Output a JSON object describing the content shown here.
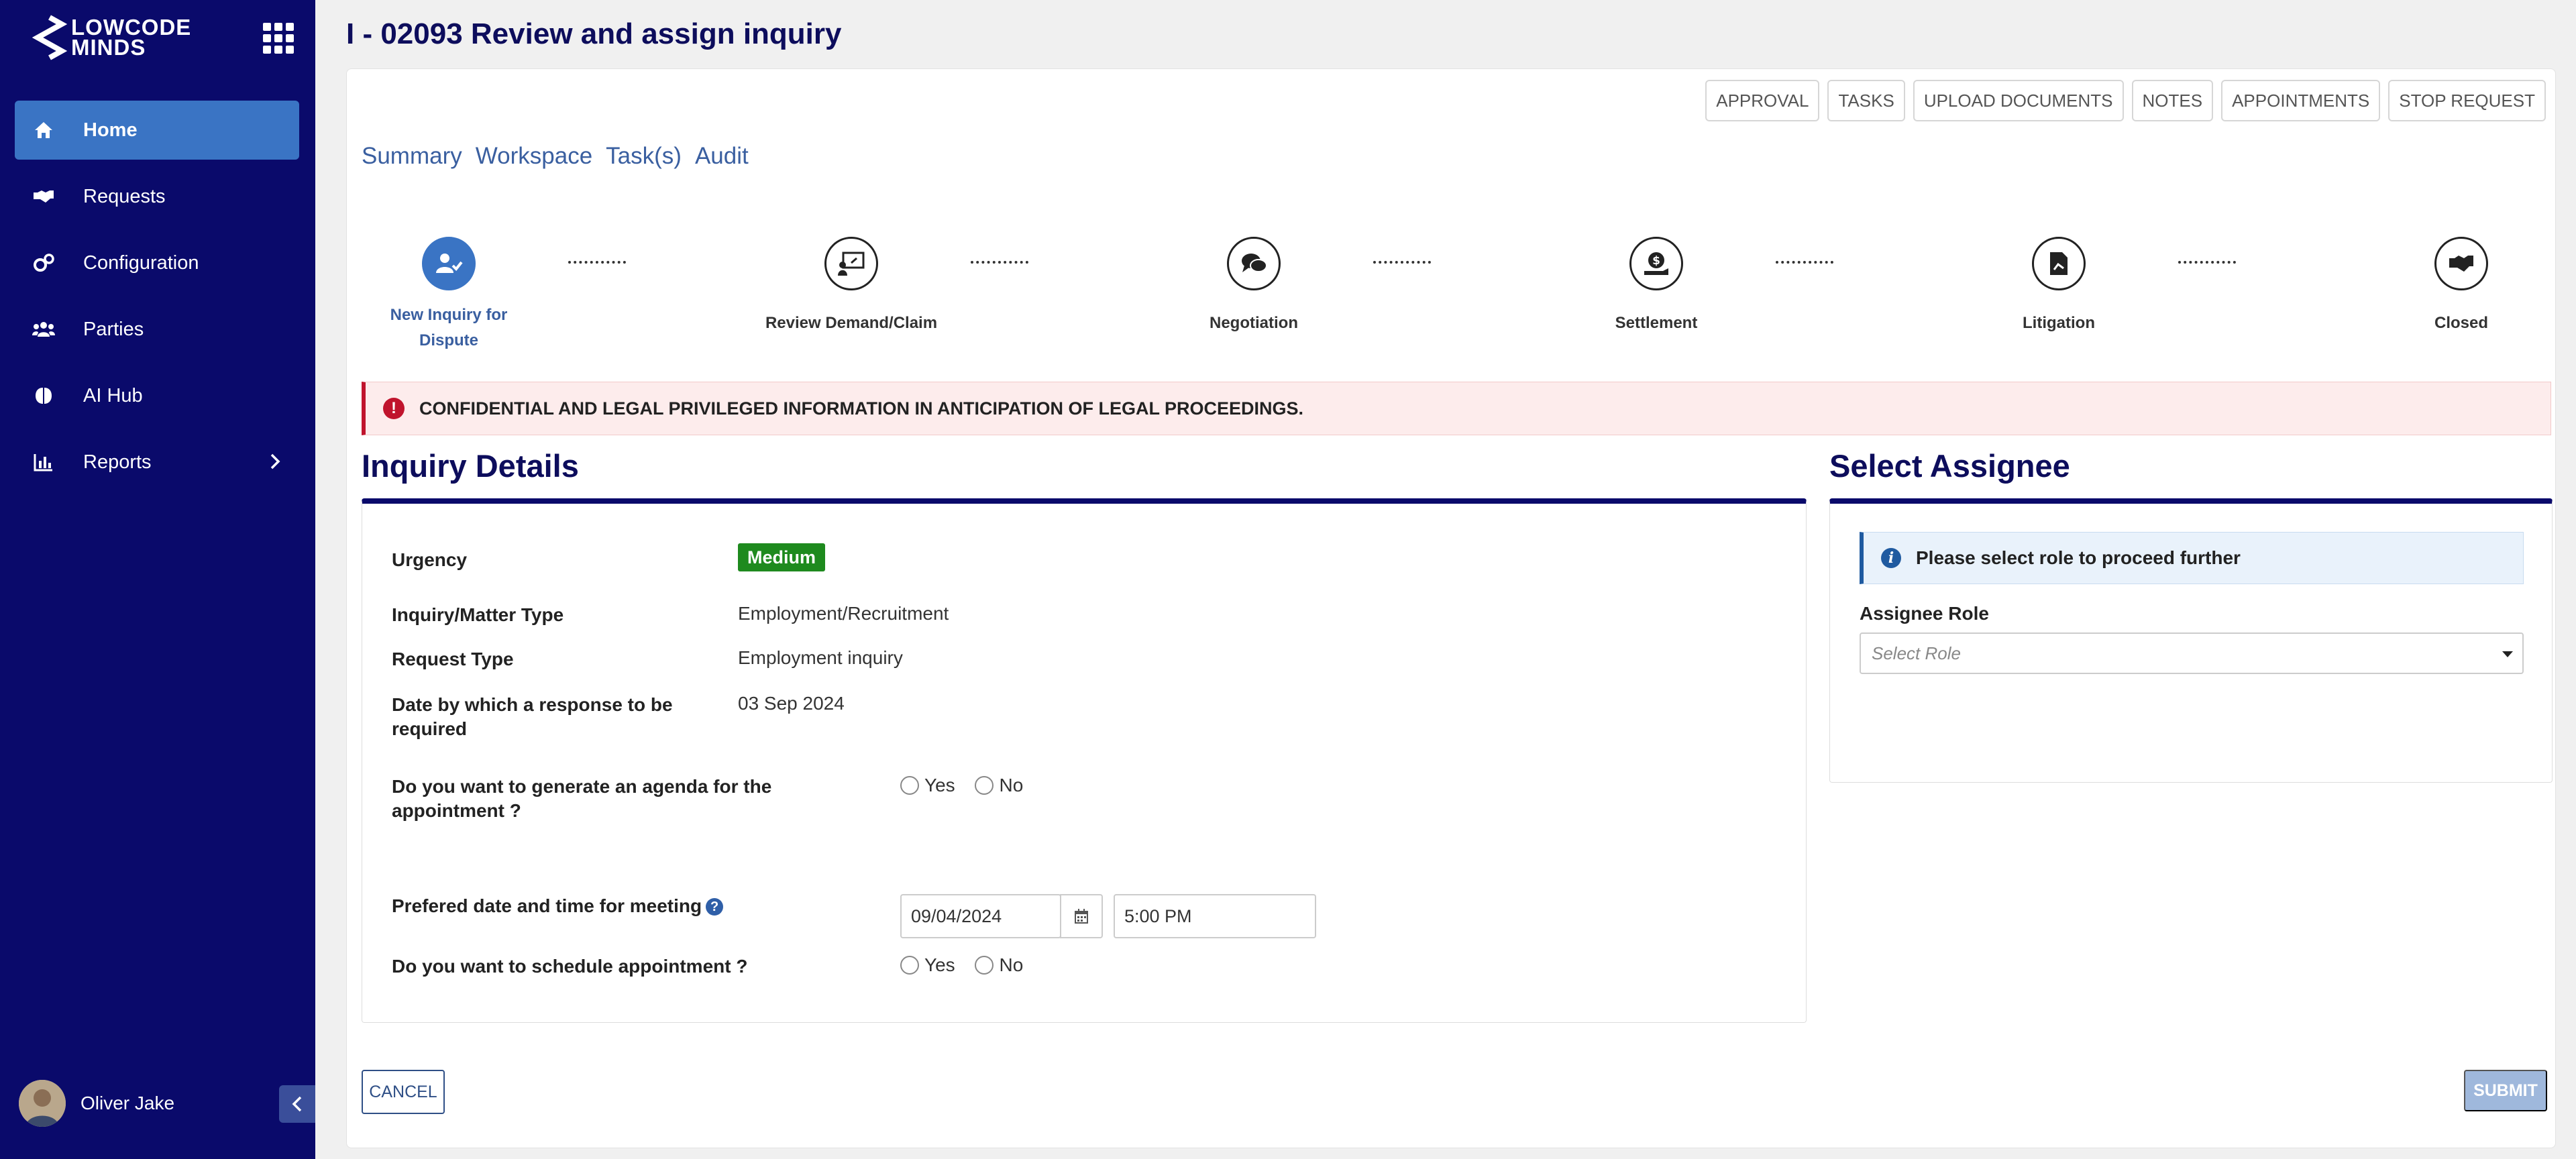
{
  "brand": {
    "line1": "LOWCODE",
    "line2": "MINDS"
  },
  "sidebar": {
    "items": [
      {
        "label": "Home",
        "icon": "home-icon",
        "active": true
      },
      {
        "label": "Requests",
        "icon": "handshake-icon"
      },
      {
        "label": "Configuration",
        "icon": "cogs-icon"
      },
      {
        "label": "Parties",
        "icon": "users-icon"
      },
      {
        "label": "AI Hub",
        "icon": "brain-icon"
      },
      {
        "label": "Reports",
        "icon": "chart-icon",
        "has_submenu": true
      }
    ],
    "user": {
      "name": "Oliver Jake"
    }
  },
  "header": {
    "title": "I - 02093 Review and assign inquiry"
  },
  "actions": {
    "approval": "APPROVAL",
    "tasks": "TASKS",
    "upload": "UPLOAD DOCUMENTS",
    "notes": "NOTES",
    "appointments": "APPOINTMENTS",
    "stop": "STOP REQUEST"
  },
  "tabs": {
    "summary": "Summary",
    "workspace": "Workspace",
    "tasks": "Task(s)",
    "audit": "Audit"
  },
  "stepper": {
    "steps": [
      {
        "label_line1": "New Inquiry for",
        "label_line2": "Dispute",
        "icon": "user-check-icon",
        "active": true
      },
      {
        "label_line1": "Review Demand/Claim",
        "icon": "presentation-icon"
      },
      {
        "label_line1": "Negotiation",
        "icon": "comments-icon"
      },
      {
        "label_line1": "Settlement",
        "icon": "money-hand-icon"
      },
      {
        "label_line1": "Litigation",
        "icon": "document-icon"
      },
      {
        "label_line1": "Closed",
        "icon": "handshake-icon"
      }
    ]
  },
  "alert": {
    "text": "CONFIDENTIAL AND LEGAL PRIVILEGED INFORMATION IN ANTICIPATION OF LEGAL PROCEEDINGS.",
    "color": "#c0142d"
  },
  "inquiry": {
    "title": "Inquiry Details",
    "urgency_label": "Urgency",
    "urgency_value": "Medium",
    "matter_type_label": "Inquiry/Matter Type",
    "matter_type_value": "Employment/Recruitment",
    "request_type_label": "Request Type",
    "request_type_value": "Employment inquiry",
    "date_label": "Date by which a response to be required",
    "date_value": "03 Sep 2024",
    "agenda_label": "Do you want to generate an agenda for the appointment ?",
    "yes": "Yes",
    "no": "No",
    "meeting_label": "Prefered date and time for meeting",
    "meeting_date": "09/04/2024",
    "meeting_time": "5:00 PM",
    "schedule_label": "Do you want to schedule appointment ?"
  },
  "assignee": {
    "title": "Select Assignee",
    "info": "Please select role to proceed further",
    "role_label": "Assignee Role",
    "role_placeholder": "Select Role"
  },
  "footer": {
    "cancel": "CANCEL",
    "submit": "SUBMIT"
  },
  "colors": {
    "sidebar": "#0a0a6b",
    "active_nav": "#3a74c4",
    "urgency_badge": "#1e8a1e",
    "info_border": "#1f5aa0"
  }
}
